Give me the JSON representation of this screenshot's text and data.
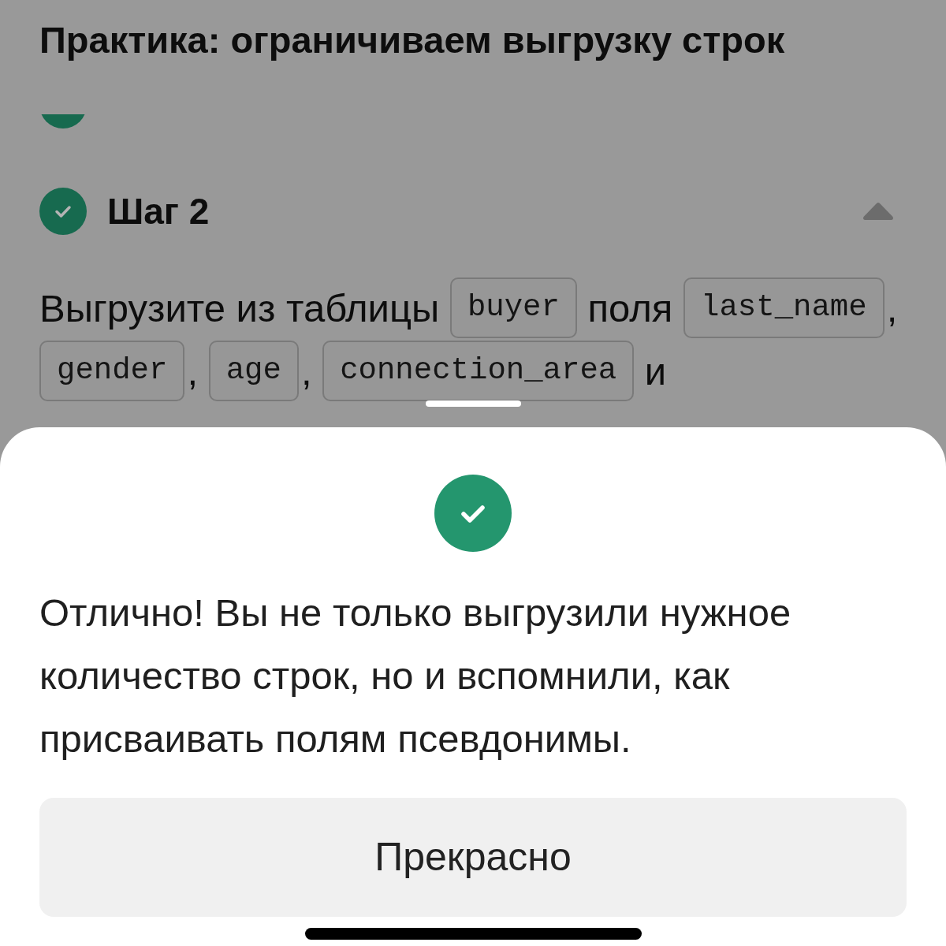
{
  "header": {
    "title": "Практика: ограничиваем выгрузку строк"
  },
  "steps": [
    {
      "completed": true
    },
    {
      "title": "Шаг 2",
      "completed": true,
      "expanded": true,
      "body": [
        {
          "kind": "text",
          "text": "Выгрузите из таблицы"
        },
        {
          "kind": "code",
          "text": "buyer"
        },
        {
          "kind": "text",
          "text": "поля"
        },
        {
          "kind": "code",
          "text": "last_name"
        },
        {
          "kind": "punctuation",
          "text": ","
        },
        {
          "kind": "code",
          "text": "gender"
        },
        {
          "kind": "punctuation",
          "text": ","
        },
        {
          "kind": "code",
          "text": "age"
        },
        {
          "kind": "punctuation",
          "text": ","
        },
        {
          "kind": "code",
          "text": "connection_area"
        },
        {
          "kind": "text",
          "text": "и"
        }
      ]
    }
  ],
  "sheet": {
    "passed": true,
    "message": "Отлично! Вы не только выгрузили нужное количество строк, но и вспомнили, как присваивать полям псевдонимы.",
    "button": "Прекрасно"
  }
}
